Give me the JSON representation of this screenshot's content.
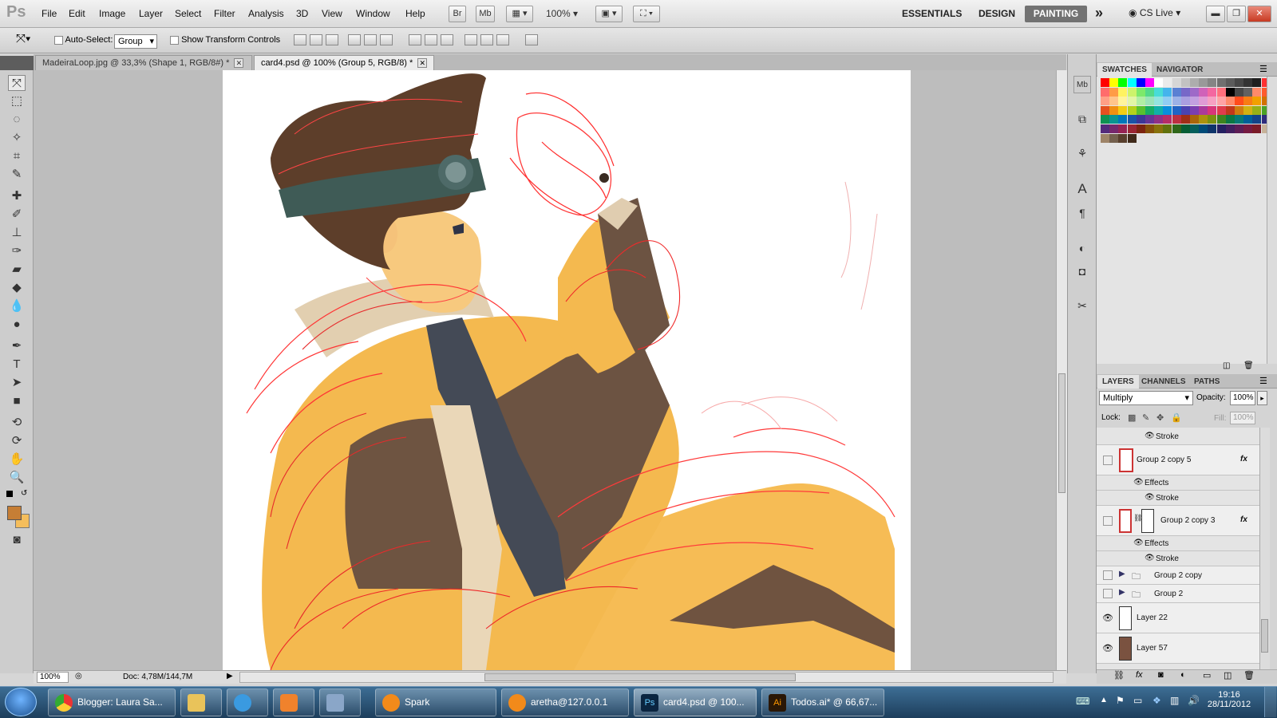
{
  "app": {
    "menus": [
      "File",
      "Edit",
      "Image",
      "Layer",
      "Select",
      "Filter",
      "Analysis",
      "3D",
      "View",
      "Window",
      "Help"
    ],
    "mini_bridge": "Br",
    "mini_mb": "Mb",
    "zoom": "100%",
    "workspaces": [
      "ESSENTIALS",
      "DESIGN",
      "PAINTING"
    ],
    "more": "»",
    "cs_live": "CS Live"
  },
  "options": {
    "auto_select_label": "Auto-Select:",
    "auto_select_value": "Group",
    "transform_label": "Show Transform Controls"
  },
  "doc_tabs": [
    {
      "label": "MadeiraLoop.jpg @ 33,3% (Shape 1, RGB/8#) *"
    },
    {
      "label": "card4.psd @ 100% (Group 5, RGB/8) *"
    }
  ],
  "status": {
    "zoom": "100%",
    "doc": "Doc: 4,78M/144,7M"
  },
  "panels": {
    "tabs_top": [
      "SWATCHES",
      "NAVIGATOR"
    ],
    "tabs_layers": [
      "LAYERS",
      "CHANNELS",
      "PATHS"
    ],
    "blend_mode": "Multiply",
    "opacity_label": "Opacity:",
    "opacity": "100%",
    "lock_label": "Lock:",
    "fill_label": "Fill:",
    "fill": "100%",
    "layers": [
      {
        "name": "Stroke",
        "type": "effect-item"
      },
      {
        "name": "Group 2 copy 5",
        "type": "layer",
        "fx": "fx"
      },
      {
        "name": "Effects",
        "type": "effects"
      },
      {
        "name": "Stroke",
        "type": "effect-item"
      },
      {
        "name": "Group 2 copy 3",
        "type": "layer",
        "fx": "fx"
      },
      {
        "name": "Effects",
        "type": "effects"
      },
      {
        "name": "Stroke",
        "type": "effect-item"
      },
      {
        "name": "Group 2 copy",
        "type": "group"
      },
      {
        "name": "Group 2",
        "type": "group"
      },
      {
        "name": "Layer 22",
        "type": "layer"
      },
      {
        "name": "Layer 57",
        "type": "layer"
      }
    ]
  },
  "swatches": {
    "rows": [
      [
        "#ff0000",
        "#ffff00",
        "#00ff00",
        "#00ffff",
        "#0000ff",
        "#ff00ff",
        "#ffffff",
        "#ebebeb",
        "#d6d6d6",
        "#c2c2c2",
        "#adadad",
        "#999999",
        "#858585",
        "#707070",
        "#5c5c5c",
        "#474747",
        "#333333",
        "#1f1f1f",
        "#ff3030"
      ],
      [
        "#ff6c6c",
        "#ff9c46",
        "#fff361",
        "#cdf36b",
        "#7de96b",
        "#53d98a",
        "#48dcd7",
        "#45b4ec",
        "#5a80d3",
        "#7768c8",
        "#9e6ac8",
        "#d062b9",
        "#f467a0",
        "#ff6f7c",
        "#000000",
        "#474747",
        "#616161",
        "#ff8a6a",
        "#ff5a2c"
      ],
      [
        "#ff9f86",
        "#ffc58b",
        "#fff49b",
        "#e2f6a6",
        "#b1eea4",
        "#9be3b8",
        "#93e4e0",
        "#91cdf3",
        "#9cb2e7",
        "#a99fe0",
        "#c3a0e0",
        "#e09cd5",
        "#f7a0c2",
        "#ffa2a5",
        "#ff8a6a",
        "#ff4c1c",
        "#f87c14",
        "#f2a000",
        "#d27100"
      ],
      [
        "#e45020",
        "#f09012",
        "#f3cd14",
        "#b5d11b",
        "#59c02e",
        "#18ad63",
        "#11afa8",
        "#0a8edb",
        "#2164c4",
        "#4a43b2",
        "#7a3fb1",
        "#ab3a9c",
        "#d9367a",
        "#e13b4d",
        "#c2371c",
        "#cf7c10",
        "#d2b112",
        "#98b016",
        "#4ba125"
      ],
      [
        "#0f9252",
        "#0a9490",
        "#0076ba",
        "#1a53a6",
        "#3c3697",
        "#663496",
        "#903085",
        "#b62d66",
        "#bd2f40",
        "#a02e17",
        "#a9660b",
        "#ac920e",
        "#7c9111",
        "#3d841f",
        "#0b7843",
        "#077975",
        "#005f98",
        "#134388",
        "#2f2b7c"
      ],
      [
        "#542a7b",
        "#76276d",
        "#952253",
        "#9a2634",
        "#7c2410",
        "#855009",
        "#88720b",
        "#61720d",
        "#2f6719",
        "#075d34",
        "#055e5b",
        "#004a77",
        "#0e346a",
        "#242061",
        "#421f5f",
        "#5d1d56",
        "#751a41",
        "#7a1b28",
        "#c7b299"
      ],
      [
        "#9e8468",
        "#74604e",
        "#583f2d",
        "#3f2a1a"
      ]
    ]
  }
}
